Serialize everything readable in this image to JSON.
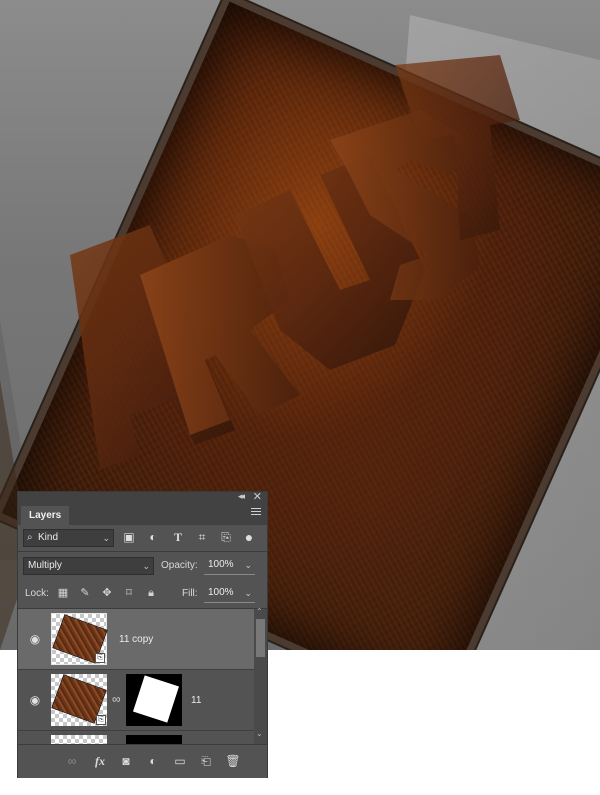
{
  "panel": {
    "tab_label": "Layers",
    "filter_kind": "Kind",
    "blend_mode": "Multiply",
    "opacity_label": "Opacity:",
    "opacity_value": "100%",
    "lock_label": "Lock:",
    "fill_label": "Fill:",
    "fill_value": "100%"
  },
  "layers": [
    {
      "name": "11 copy",
      "selected": true,
      "has_mask": false
    },
    {
      "name": "11",
      "selected": false,
      "has_mask": true
    }
  ],
  "icons": {
    "filter": [
      "image-filter-icon",
      "adjustment-filter-icon",
      "type-filter-icon",
      "shape-filter-icon",
      "smart-object-filter-icon",
      "filter-toggle-icon"
    ],
    "lock": [
      "lock-transparent-pixels-icon",
      "lock-image-pixels-icon",
      "lock-position-icon",
      "lock-artboard-icon",
      "lock-all-icon"
    ],
    "bottom": [
      "link-layers-icon",
      "fx-icon",
      "add-mask-icon",
      "new-adjustment-icon",
      "new-group-icon",
      "new-layer-icon",
      "delete-icon"
    ]
  },
  "colors": {
    "panel_bg": "#535353",
    "selected_row": "#6a6a6a",
    "field_bg": "#3e3e3e"
  }
}
